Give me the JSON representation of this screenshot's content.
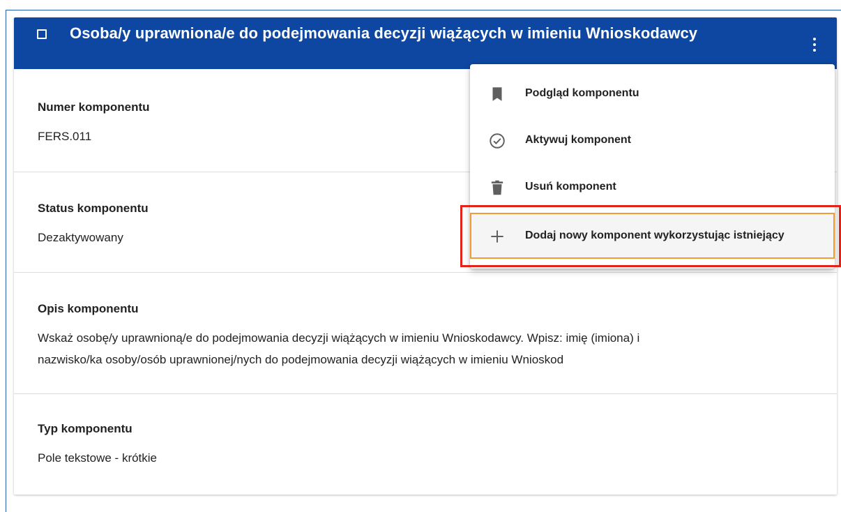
{
  "card": {
    "title": "Osoba/y uprawniona/e do podejmowania decyzji wiążących w imieniu Wnioskodawcy",
    "header_color": "#0d47a1"
  },
  "fields": {
    "number": {
      "label": "Numer komponentu",
      "value": "FERS.011"
    },
    "status": {
      "label": "Status komponentu",
      "value": "Dezaktywowany"
    },
    "description": {
      "label": "Opis komponentu",
      "line1": "Wskaż osobę/y uprawnioną/e do podejmowania decyzji wiążących w imieniu Wnioskodawcy. Wpisz: imię (imiona) i",
      "line2": "nazwisko/ka osoby/osób uprawnionej/nych do podejmowania decyzji wiążących w imieniu Wnioskod"
    },
    "type": {
      "label": "Typ komponentu",
      "value": "Pole tekstowe - krótkie"
    }
  },
  "menu": {
    "items": [
      {
        "label": "Podgląd komponentu",
        "icon": "bookmark-icon"
      },
      {
        "label": "Aktywuj komponent",
        "icon": "check-circle-icon"
      },
      {
        "label": "Usuń komponent",
        "icon": "trash-icon"
      },
      {
        "label": "Dodaj nowy komponent wykorzystując istniejący",
        "icon": "plus-icon"
      }
    ],
    "highlight_color": "#e2231a",
    "selected_border_color": "#f39c34"
  }
}
